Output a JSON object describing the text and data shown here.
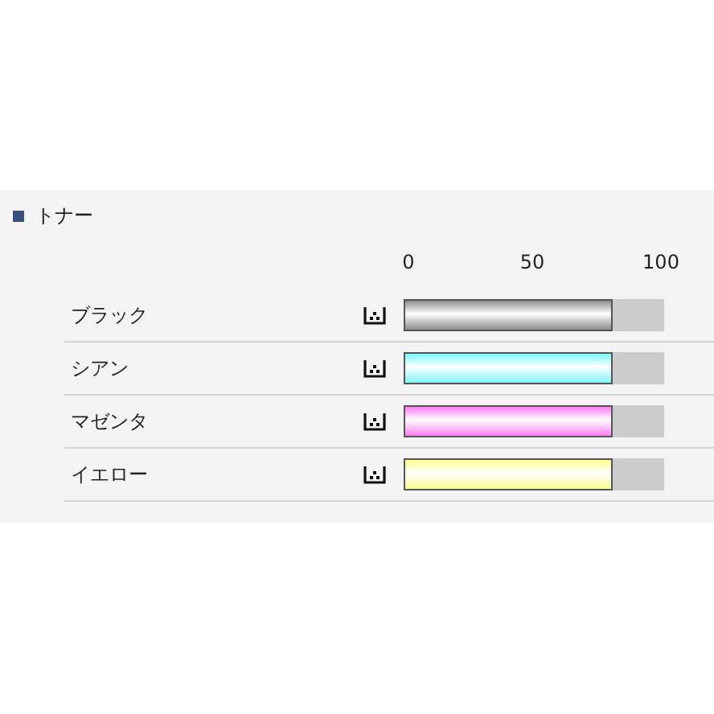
{
  "section": {
    "title": "トナー"
  },
  "scale": [
    "0",
    "50",
    "100"
  ],
  "toners": [
    {
      "name": "ブラック",
      "level": 0.8,
      "color": "#8c8c8c"
    },
    {
      "name": "シアン",
      "level": 0.8,
      "color": "#7ff6fa"
    },
    {
      "name": "マゼンタ",
      "level": 0.8,
      "color": "#ff7cf5"
    },
    {
      "name": "イエロー",
      "level": 0.8,
      "color": "#fbfd8e"
    }
  ]
}
